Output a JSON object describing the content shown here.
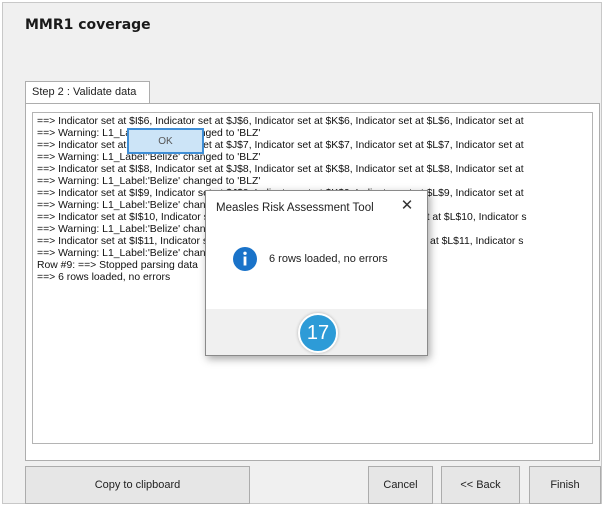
{
  "window": {
    "title": "MMR1 coverage"
  },
  "tabs": [
    {
      "label": "Step 2 : Validate data"
    }
  ],
  "log_lines": [
    "==> Indicator set at $I$6, Indicator set at $J$6, Indicator set at $K$6, Indicator set at $L$6, Indicator set at",
    "==> Warning: L1_Label:'Belize' changed to 'BLZ'",
    "==> Indicator set at $I$7, Indicator set at $J$7, Indicator set at $K$7, Indicator set at $L$7, Indicator set at",
    "==> Warning: L1_Label:'Belize' changed to 'BLZ'",
    "==> Indicator set at $I$8, Indicator set at $J$8, Indicator set at $K$8, Indicator set at $L$8, Indicator set at",
    "==> Warning: L1_Label:'Belize' changed to 'BLZ'",
    "==> Indicator set at $I$9, Indicator set at $J$9, Indicator set at $K$9, Indicator set at $L$9, Indicator set at",
    "==> Warning: L1_Label:'Belize' changed to 'BLZ'",
    "==> Indicator set at $I$10, Indicator set at $J$10, Indicator set at $K$10, Indicator set at $L$10, Indicator s",
    "==> Warning: L1_Label:'Belize' changed to 'BLZ'",
    "==> Indicator set at $I$11, Indicator set at $J$11, Indicator set at $K$11, Indicator set at $L$11, Indicator s",
    "==> Warning: L1_Label:'Belize' changed to 'BLZ'",
    "Row #9: ==> Stopped parsing data",
    "==> 6 rows loaded, no errors"
  ],
  "buttons": {
    "copy": "Copy to clipboard",
    "cancel": "Cancel",
    "back": "<< Back",
    "finish": "Finish"
  },
  "modal": {
    "title": "Measles Risk Assessment Tool",
    "close_glyph": "✕",
    "message": "6 rows loaded, no errors",
    "ok_label": "OK",
    "icon": "info-icon"
  },
  "step_badge": {
    "number": "17",
    "color": "#2d9bd7"
  },
  "colors": {
    "accent": "#3f8ed6",
    "info_icon": "#1a73c9"
  }
}
